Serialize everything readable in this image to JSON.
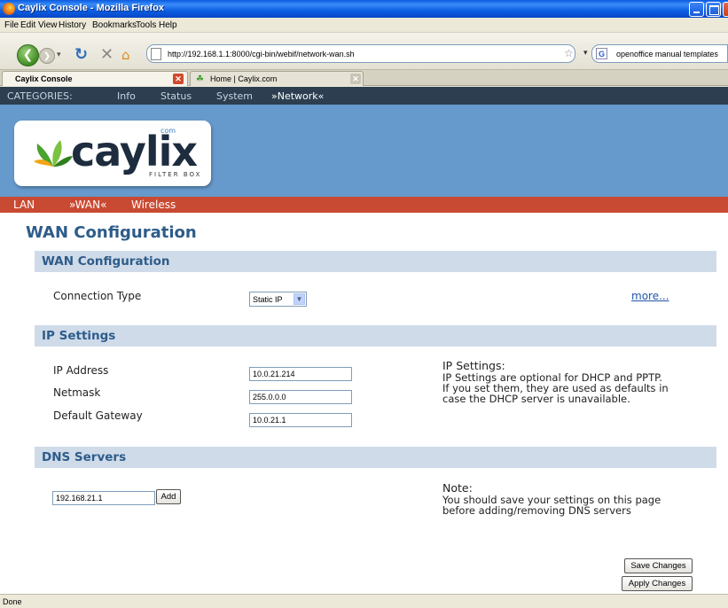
{
  "window": {
    "title": "Caylix Console - Mozilla Firefox"
  },
  "menu": [
    "File",
    "Edit",
    "View",
    "History",
    "Bookmarks",
    "Tools",
    "Help"
  ],
  "navbar": {
    "url": "http://192.168.1.1:8000/cgi-bin/webif/network-wan.sh",
    "search_text": "openoffice manual templates"
  },
  "tabs": [
    {
      "label": "Caylix Console",
      "active": true
    },
    {
      "label": "Home | Caylix.com",
      "active": false
    }
  ],
  "categories": {
    "label": "CATEGORIES:",
    "items": [
      "Info",
      "Status",
      "System",
      "»Network«"
    ]
  },
  "logo": {
    "word": "caylix",
    "com": "com",
    "tagline": "FILTER BOX"
  },
  "subnav": [
    "LAN",
    "»WAN«",
    "Wireless"
  ],
  "page_title": "WAN Configuration",
  "wan_section": {
    "title": "WAN Configuration",
    "connection_type_label": "Connection Type",
    "connection_type_value": "Static IP",
    "more_link": "more..."
  },
  "ip_section": {
    "title": "IP Settings",
    "ip_label": "IP Address",
    "ip_value": "10.0.21.214",
    "netmask_label": "Netmask",
    "netmask_value": "255.0.0.0",
    "gateway_label": "Default Gateway",
    "gateway_value": "10.0.21.1",
    "help_title": "IP Settings:",
    "help_lines": [
      "IP Settings are optional for DHCP and PPTP.",
      "If you set them, they are used as defaults in",
      "case the DHCP server is unavailable."
    ]
  },
  "dns_section": {
    "title": "DNS Servers",
    "dns_value": "192.168.21.1",
    "add_label": "Add",
    "note_title": "Note:",
    "note_lines": [
      "You should save your settings on this page",
      "before adding/removing DNS servers"
    ]
  },
  "buttons": {
    "save": "Save Changes",
    "apply": "Apply Changes"
  },
  "statusbar": {
    "text": "Done"
  },
  "colors": {
    "titlebar": "#0c5fe3",
    "category_bar": "#2c3e50",
    "banner": "#6699cc",
    "subnav": "#c94a32",
    "section_bar": "#cfdbe9",
    "heading": "#2e5c8a"
  }
}
